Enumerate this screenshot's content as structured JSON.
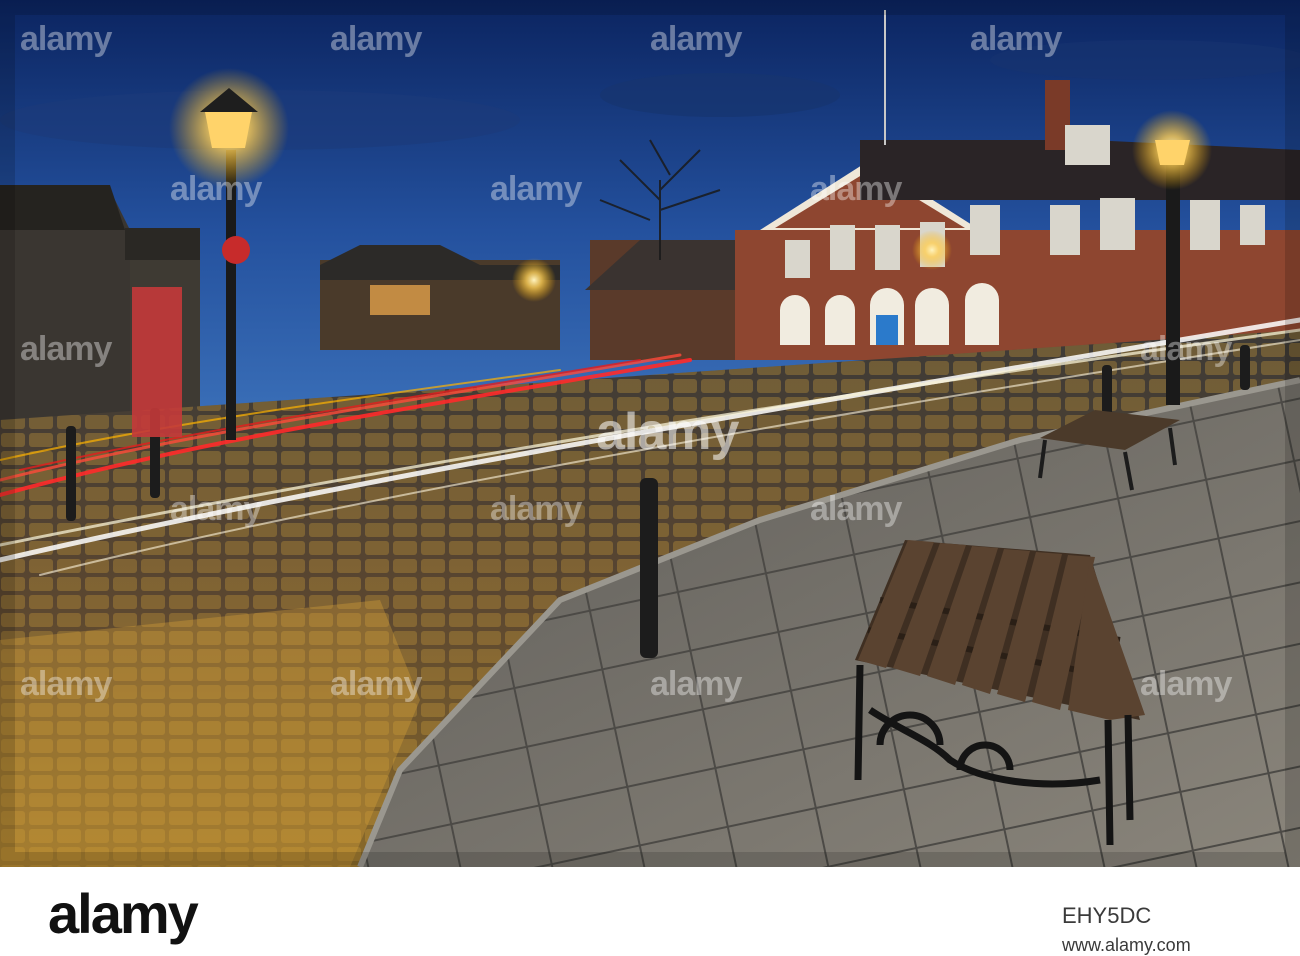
{
  "photo": {
    "sky_top": "#0d2a66",
    "sky_bottom": "#2f64b3",
    "lamp_glow": "#ffd36a",
    "brick": "#9a4a2e",
    "cobble": "#4a3d2f",
    "paving": "#6b6760"
  },
  "watermark": {
    "word": "alamy",
    "footer_logo": "alamy",
    "image_id": "EHY5DC",
    "url": "www.alamy.com"
  }
}
